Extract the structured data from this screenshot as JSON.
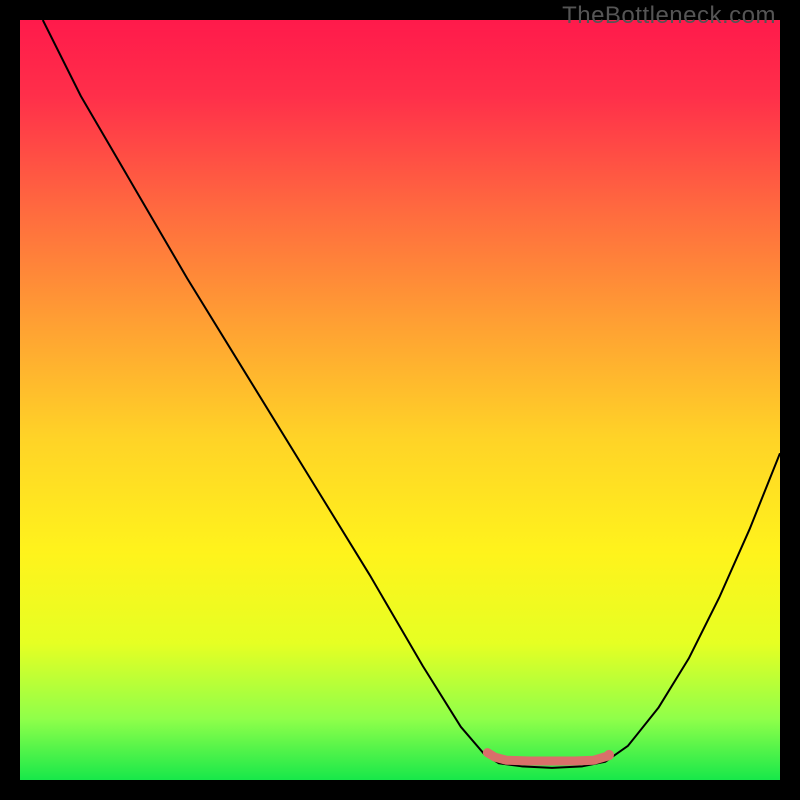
{
  "watermark": "TheBottleneck.com",
  "chart_data": {
    "type": "line",
    "title": "",
    "xlabel": "",
    "ylabel": "",
    "xlim": [
      0,
      100
    ],
    "ylim": [
      0,
      100
    ],
    "grid": false,
    "legend": false,
    "background_gradient": {
      "stops": [
        {
          "offset": 0.0,
          "color": "#ff1a4b"
        },
        {
          "offset": 0.1,
          "color": "#ff2f4a"
        },
        {
          "offset": 0.25,
          "color": "#ff6a3f"
        },
        {
          "offset": 0.4,
          "color": "#ffa033"
        },
        {
          "offset": 0.55,
          "color": "#ffd327"
        },
        {
          "offset": 0.7,
          "color": "#fff31c"
        },
        {
          "offset": 0.82,
          "color": "#e6ff23"
        },
        {
          "offset": 0.92,
          "color": "#8fff4a"
        },
        {
          "offset": 1.0,
          "color": "#17e84a"
        }
      ]
    },
    "series": [
      {
        "name": "bottleneck-curve",
        "color": "#000000",
        "stroke_width": 2,
        "points": [
          {
            "x": 3.0,
            "y": 100.0
          },
          {
            "x": 8.0,
            "y": 90.0
          },
          {
            "x": 15.0,
            "y": 78.0
          },
          {
            "x": 22.0,
            "y": 66.0
          },
          {
            "x": 30.0,
            "y": 53.0
          },
          {
            "x": 38.0,
            "y": 40.0
          },
          {
            "x": 46.0,
            "y": 27.0
          },
          {
            "x": 53.0,
            "y": 15.0
          },
          {
            "x": 58.0,
            "y": 7.0
          },
          {
            "x": 61.0,
            "y": 3.5
          },
          {
            "x": 63.0,
            "y": 2.2
          },
          {
            "x": 66.0,
            "y": 1.8
          },
          {
            "x": 70.0,
            "y": 1.6
          },
          {
            "x": 74.0,
            "y": 1.8
          },
          {
            "x": 77.0,
            "y": 2.4
          },
          {
            "x": 80.0,
            "y": 4.5
          },
          {
            "x": 84.0,
            "y": 9.5
          },
          {
            "x": 88.0,
            "y": 16.0
          },
          {
            "x": 92.0,
            "y": 24.0
          },
          {
            "x": 96.0,
            "y": 33.0
          },
          {
            "x": 100.0,
            "y": 43.0
          }
        ]
      }
    ],
    "markers": [
      {
        "name": "optimal-region",
        "color": "#d9706a",
        "stroke_width": 9,
        "stroke_linecap": "round",
        "points": [
          {
            "x": 61.5,
            "y": 3.6
          },
          {
            "x": 62.5,
            "y": 3.0
          },
          {
            "x": 64.0,
            "y": 2.6
          },
          {
            "x": 67.0,
            "y": 2.5
          },
          {
            "x": 70.0,
            "y": 2.5
          },
          {
            "x": 73.0,
            "y": 2.5
          },
          {
            "x": 75.5,
            "y": 2.6
          },
          {
            "x": 77.5,
            "y": 3.2
          }
        ]
      },
      {
        "name": "optimal-end-dot",
        "type": "dot",
        "color": "#d9706a",
        "radius": 5,
        "x": 77.5,
        "y": 3.3
      }
    ]
  }
}
